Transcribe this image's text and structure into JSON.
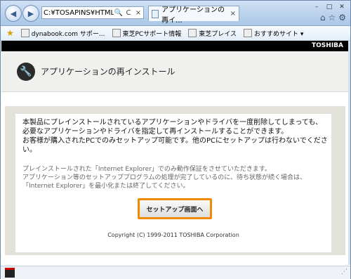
{
  "browser": {
    "address": "C:¥TOSAPINS¥HTML¥S",
    "tab_title": "アプリケーションの再イ...",
    "tab_close": "×",
    "back_icon": "◀",
    "forward_icon": "▶",
    "search_icon": "🔍",
    "refresh_icon": "C",
    "stop_icon": "×",
    "win_min": "–",
    "win_max": "□",
    "win_close": "✕"
  },
  "favorites": {
    "star": "★",
    "items": [
      {
        "label": "dynabook.com サポー..."
      },
      {
        "label": "東芝PCサポート情報"
      },
      {
        "label": "東芝プレイス"
      },
      {
        "label": "おすすめサイト ▾"
      }
    ]
  },
  "page": {
    "brand": "TOSHIBA",
    "title": "アプリケーションの再インストール",
    "para1_line1": "本製品にプレインストールされているアプリケーションやドライバを一度削除してしまっても、",
    "para1_line2": "必要なアプリケーションやドライバを指定して再インストールすることができます。",
    "para1_line3": "お客様が購入されたPCでのみセットアップ可能です。他のPCにセットアップは行わないでください。",
    "para2_line1": "プレインストールされた「Internet Explorer」でのみ動作保証をさせていただきます。",
    "para2_line2": "アプリケーション等のセットアッププログラムの処理が完了しているのに、待ち状態が続く場合は、「Internet Explorer」を最小化または終了してください。",
    "setup_button": "セットアップ画面へ",
    "copyright": "Copyright (C) 1999-2011 TOSHIBA Corporation"
  },
  "colors": {
    "accent_button_border": "#f08a00",
    "content_frame": "#e2e2da"
  }
}
